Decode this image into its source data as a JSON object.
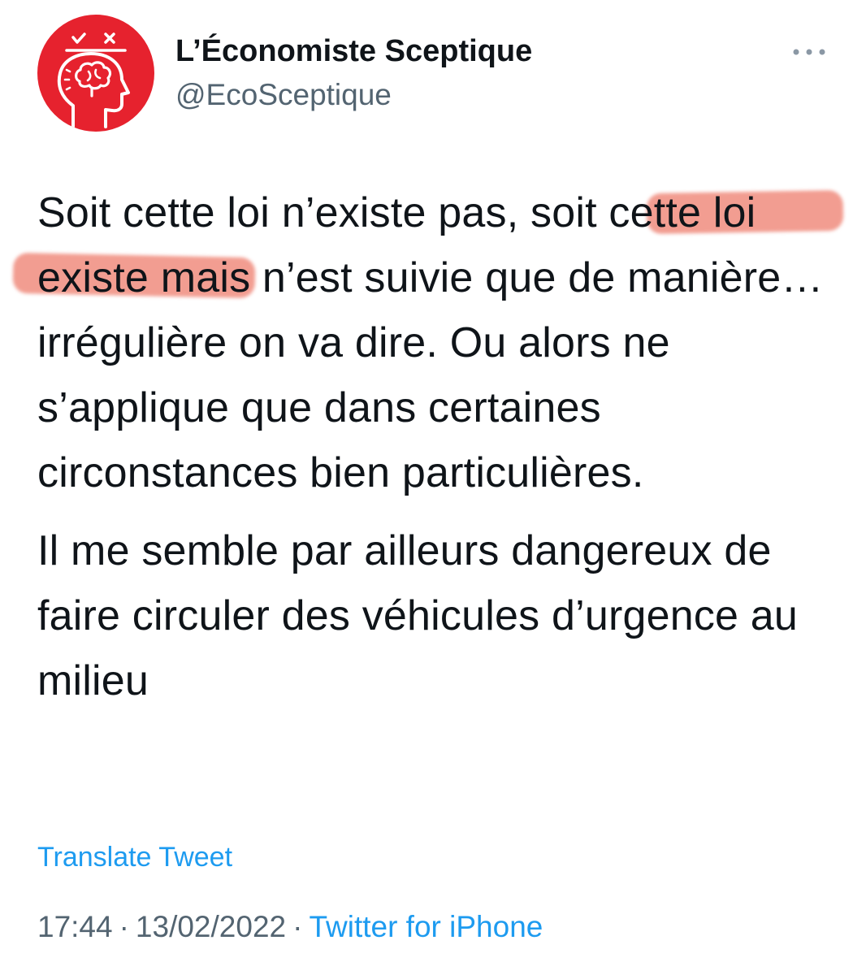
{
  "author": {
    "display_name": "L’Économiste Sceptique",
    "handle": "@EcoSceptique",
    "avatar_icon": "head-brain-check-cross-icon",
    "avatar_color": "#e6222e"
  },
  "more_icon": "more-dots-icon",
  "tweet": {
    "paragraph1": {
      "part1": "Soit cette loi n’existe pas, so",
      "part2": "it cette loi existe ",
      "part3": "mais n’est suivie que de manière… irrégulière on va dire. Ou alors ne s’applique que dans certaines circonstances bien particulières."
    },
    "paragraph2": "Il me semble par ailleurs dangereux de faire circuler des véhicules d’urgence au milieu",
    "highlight_color": "#e85642"
  },
  "translate_label": "Translate Tweet",
  "meta": {
    "time": "17:44",
    "separator": "·",
    "date": "13/02/2022",
    "source": "Twitter for iPhone"
  },
  "colors": {
    "text": "#0f1419",
    "secondary": "#536471",
    "link": "#1d9bf0"
  }
}
